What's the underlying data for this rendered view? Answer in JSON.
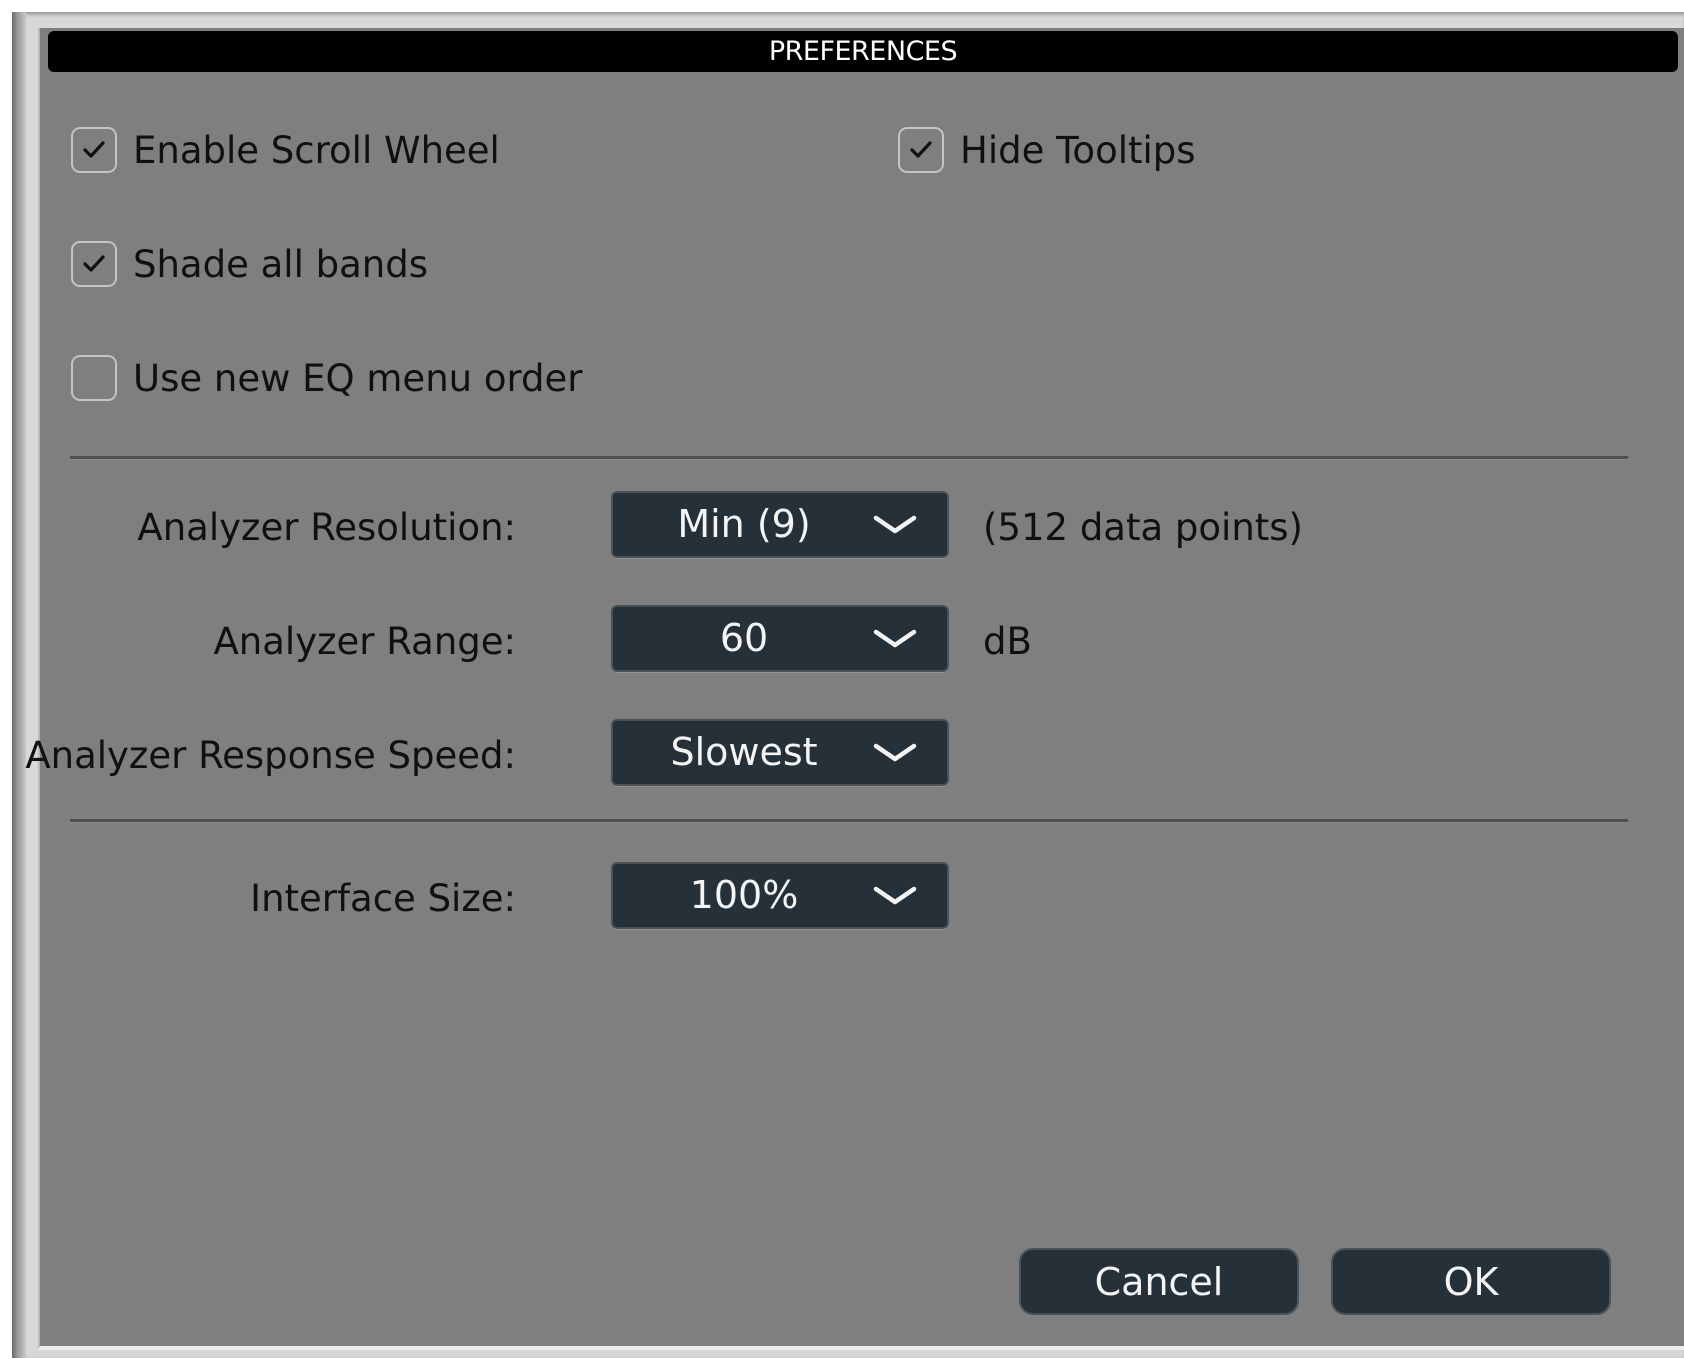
{
  "dialog": {
    "title": "PREFERENCES"
  },
  "checkboxes": {
    "enable_scroll_wheel": {
      "label": "Enable Scroll Wheel",
      "checked": true
    },
    "hide_tooltips": {
      "label": "Hide Tooltips",
      "checked": true
    },
    "shade_all_bands": {
      "label": "Shade all bands",
      "checked": true
    },
    "use_new_eq_menu_order": {
      "label": "Use new EQ menu order",
      "checked": false
    }
  },
  "analyzer": {
    "resolution": {
      "label": "Analyzer Resolution:",
      "value": "Min (9)",
      "suffix": "(512 data points)"
    },
    "range": {
      "label": "Analyzer Range:",
      "value": "60",
      "suffix": "dB"
    },
    "response_speed": {
      "label": "Analyzer Response Speed:",
      "value": "Slowest"
    }
  },
  "interface": {
    "size": {
      "label": "Interface Size:",
      "value": "100%"
    }
  },
  "buttons": {
    "cancel": "Cancel",
    "ok": "OK"
  },
  "icons": {
    "checkmark": "checkmark-icon",
    "dropdown_arrow": "chevron-down-icon"
  },
  "colors": {
    "dialog_background": "#7f7f7f",
    "title_bar": "#000000",
    "control_background": "#253038",
    "control_text": "#f4f4f4",
    "label_text": "#101010"
  }
}
